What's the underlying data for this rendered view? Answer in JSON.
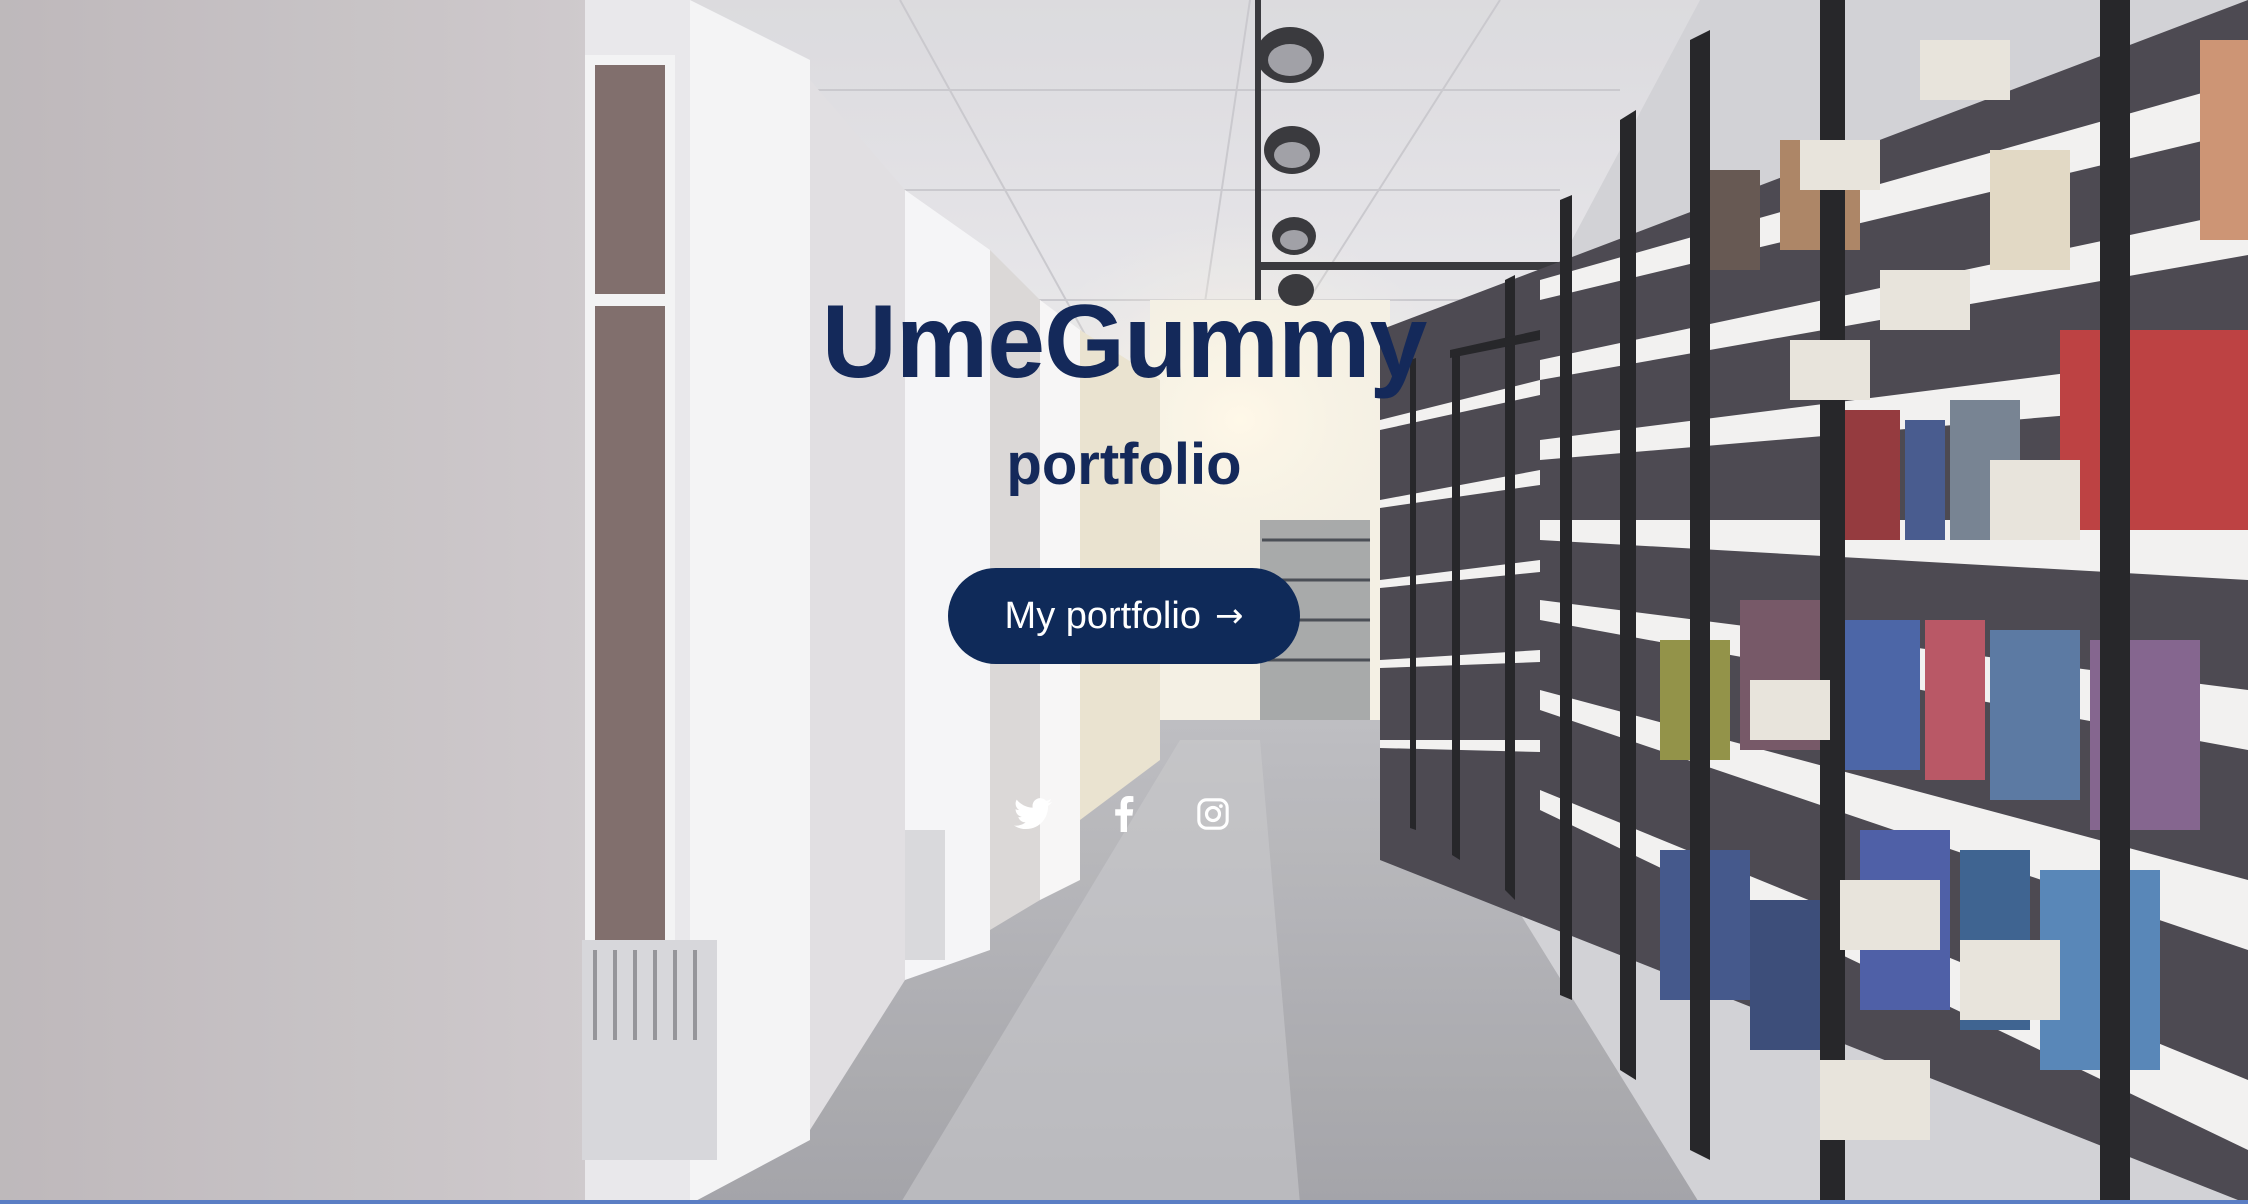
{
  "hero": {
    "title": "UmeGummy",
    "subtitle": "portfolio",
    "cta_label": "My portfolio",
    "cta_arrow": "→"
  },
  "social": [
    {
      "icon": "twitter-icon"
    },
    {
      "icon": "facebook-icon"
    },
    {
      "icon": "instagram-icon"
    }
  ],
  "colors": {
    "title": "#14295a",
    "button_bg": "#0f2a59",
    "button_text": "#ffffff",
    "icon": "#ffffff"
  }
}
